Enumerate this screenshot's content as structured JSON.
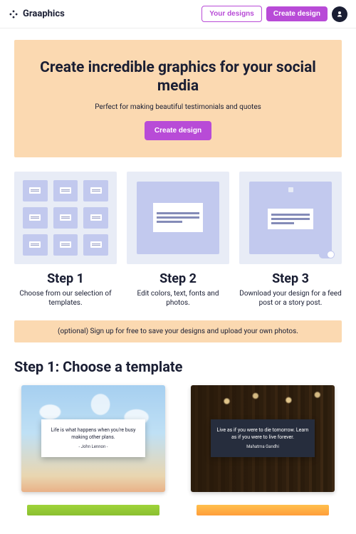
{
  "header": {
    "brand": "Graaphics",
    "your_designs": "Your designs",
    "create_design": "Create design"
  },
  "hero": {
    "title": "Create incredible graphics for your social media",
    "subtitle": "Perfect for making beautiful testimonials and quotes",
    "cta": "Create design"
  },
  "steps": [
    {
      "title": "Step 1",
      "desc": "Choose from our selection of templates."
    },
    {
      "title": "Step 2",
      "desc": "Edit colors, text, fonts and photos."
    },
    {
      "title": "Step 3",
      "desc": "Download your design for a feed post or a story post."
    }
  ],
  "signup_bar": "(optional) Sign up for free to save your designs and upload your own photos.",
  "choose_h": "Step 1: Choose a template",
  "templates": [
    {
      "quote": "Life is what happens when you're busy making other plans.",
      "author": "- John Lennon -"
    },
    {
      "quote": "Live as if you were to die tomorrow. Learn as if you were to live forever.",
      "author": "Mahatma Gandhi"
    }
  ]
}
